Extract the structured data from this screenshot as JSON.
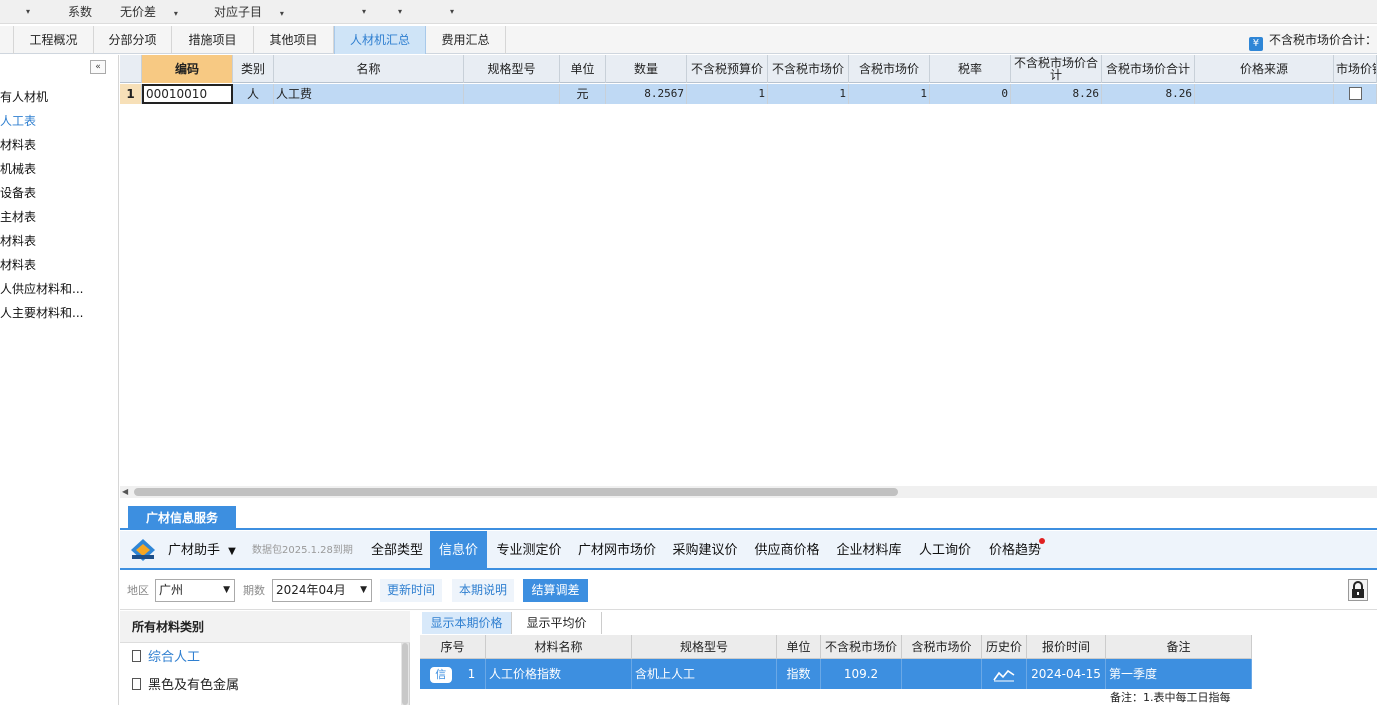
{
  "toolbar": {
    "coefficient": "系数",
    "price_diff": "无价差",
    "sub_item": "对应子目"
  },
  "tabs": [
    "工程概况",
    "分部分项",
    "措施项目",
    "其他项目",
    "人材机汇总",
    "费用汇总"
  ],
  "active_tab": "人材机汇总",
  "summary_toggle": {
    "icon": "¥",
    "label": "不含税市场价合计："
  },
  "tree": {
    "items": [
      "所有人材机",
      "人工表",
      "材料表",
      "机械表",
      "设备表",
      "主材表",
      "暂估材料表",
      "甲供材料表",
      "承包人供应材料和...",
      "发包人主要材料和..."
    ],
    "visible_text": [
      "有人材机",
      "人工表",
      "材料表",
      "机械表",
      "设备表",
      "主材表",
      "材料表",
      "材料表",
      "人供应材料和...",
      "人主要材料和..."
    ],
    "active_index": 1
  },
  "grid": {
    "columns": [
      "编码",
      "类别",
      "名称",
      "规格型号",
      "单位",
      "数量",
      "不含税预算价",
      "不含税市场价",
      "含税市场价",
      "税率",
      "不含税市场价合计",
      "含税市场价合计",
      "价格来源",
      "市场价锁"
    ],
    "rows": [
      {
        "row_num": "1",
        "code": "00010010",
        "type": "人",
        "name": "人工费",
        "spec": "",
        "unit": "元",
        "qty": "8.2567",
        "pre_tax_budget": "1",
        "pre_tax_market": "1",
        "tax_market": "1",
        "tax_rate": "0",
        "pre_tax_total": "8.26",
        "tax_total": "8.26",
        "price_source": ""
      }
    ]
  },
  "service": {
    "tab_label": "广材信息服务",
    "brand": "广材助手",
    "package_note": "数据包2025.1.28到期",
    "nav": [
      "全部类型",
      "信息价",
      "专业测定价",
      "广材网市场价",
      "采购建议价",
      "供应商价格",
      "企业材料库",
      "人工询价",
      "价格趋势"
    ],
    "active_nav": "信息价"
  },
  "filters": {
    "region_label": "地区",
    "region_value": "广州",
    "period_label": "期数",
    "period_value": "2024年04月",
    "btn_update": "更新时间",
    "btn_explain": "本期说明",
    "btn_settle": "结算调差"
  },
  "categories": {
    "title": "所有材料类别",
    "items": [
      "综合人工",
      "黑色及有色金属"
    ],
    "active_index": 0
  },
  "price_tabs": [
    "显示本期价格",
    "显示平均价"
  ],
  "price_table": {
    "columns": [
      "序号",
      "材料名称",
      "规格型号",
      "单位",
      "不含税市场价",
      "含税市场价",
      "历史价",
      "报价时间",
      "备注"
    ],
    "rows": [
      {
        "badge": "信",
        "seq": "1",
        "name": "人工价格指数",
        "spec": "含机上人工",
        "unit": "指数",
        "pre_tax": "109.2",
        "tax": "",
        "date": "2024-04-15",
        "remark": "第一季度"
      }
    ],
    "note": "备注：1.表中每工日指每"
  }
}
